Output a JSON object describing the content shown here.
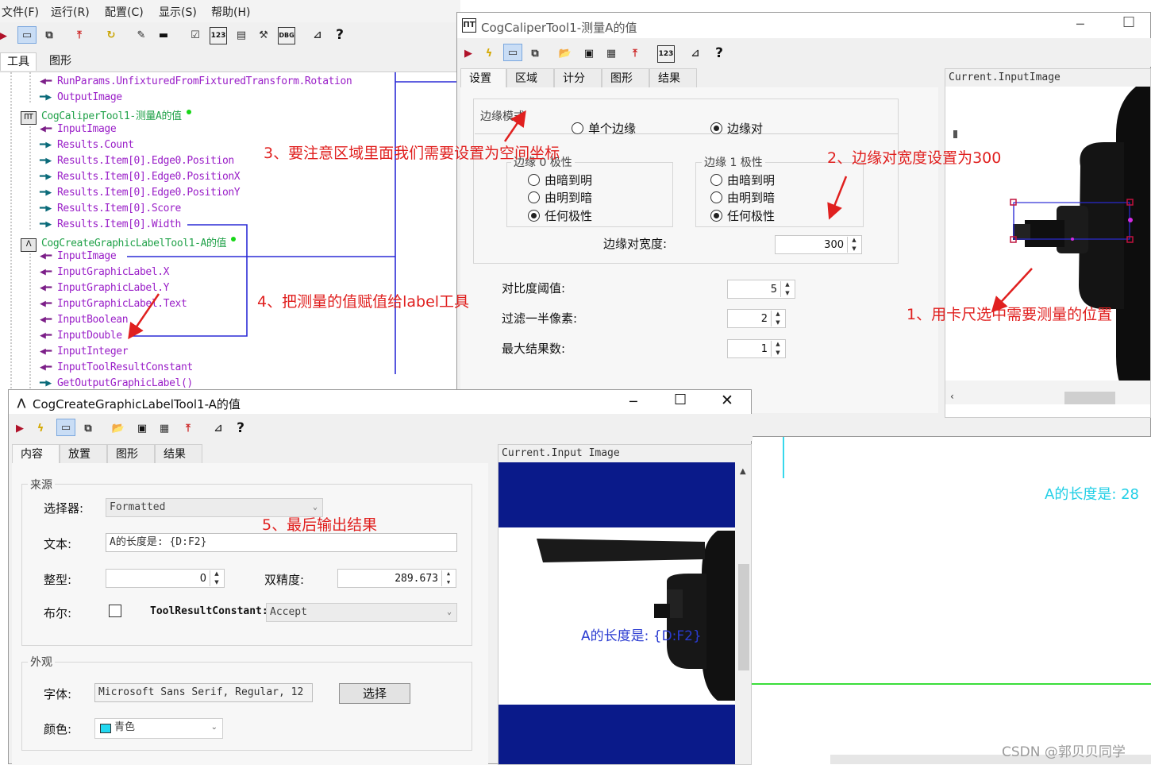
{
  "menu": [
    "文件(F)",
    "运行(R)",
    "配置(C)",
    "显示(S)",
    "帮助(H)"
  ],
  "main_tabs": [
    "工具",
    "图形"
  ],
  "tree": [
    {
      "text": "RunParams.UnfixturedFromFixturedTransform.Rotation",
      "dir": "in"
    },
    {
      "text": "OutputImage",
      "dir": "out"
    },
    {
      "text": "CogCaliperTool1-测量A的值",
      "dir": "tool"
    },
    {
      "text": "InputImage",
      "dir": "in"
    },
    {
      "text": "Results.Count",
      "dir": "out"
    },
    {
      "text": "Results.Item[0].Edge0.Position",
      "dir": "out"
    },
    {
      "text": "Results.Item[0].Edge0.PositionX",
      "dir": "out"
    },
    {
      "text": "Results.Item[0].Edge0.PositionY",
      "dir": "out"
    },
    {
      "text": "Results.Item[0].Score",
      "dir": "out"
    },
    {
      "text": "Results.Item[0].Width",
      "dir": "out"
    },
    {
      "text": "CogCreateGraphicLabelTool1-A的值",
      "dir": "tool"
    },
    {
      "text": "InputImage",
      "dir": "in"
    },
    {
      "text": "InputGraphicLabel.X",
      "dir": "in"
    },
    {
      "text": "InputGraphicLabel.Y",
      "dir": "in"
    },
    {
      "text": "InputGraphicLabel.Text",
      "dir": "in"
    },
    {
      "text": "InputBoolean",
      "dir": "in"
    },
    {
      "text": "InputDouble",
      "dir": "in"
    },
    {
      "text": "InputInteger",
      "dir": "in"
    },
    {
      "text": "InputToolResultConstant",
      "dir": "in"
    },
    {
      "text": "GetOutputGraphicLabel()",
      "dir": "out"
    }
  ],
  "caliper": {
    "title": "CogCaliperTool1-测量A的值",
    "tabs": [
      "设置",
      "区域",
      "计分",
      "图形",
      "结果"
    ],
    "edge_mode_label": "边缘模式",
    "single_edge": "单个边缘",
    "edge_pair": "边缘对",
    "edge0_polarity": "边缘 0 极性",
    "edge1_polarity": "边缘 1 极性",
    "dark_to_light": "由暗到明",
    "light_to_dark": "由明到暗",
    "any_polarity": "任何极性",
    "pair_width_label": "边缘对宽度:",
    "pair_width": "300",
    "contrast_label": "对比度阈值:",
    "contrast": "5",
    "filter_label": "过滤一半像素:",
    "filter": "2",
    "max_results_label": "最大结果数:",
    "max_results": "1",
    "image_header": "Current.InputImage",
    "scroll_left": "‹"
  },
  "label_tool": {
    "title": "CogCreateGraphicLabelTool1-A的值",
    "tabs": [
      "内容",
      "放置",
      "图形",
      "结果"
    ],
    "source_label": "来源",
    "selector_label": "选择器:",
    "selector_value": "Formatted",
    "text_label": "文本:",
    "text_value": "A的长度是: {D:F2}",
    "integer_label": "整型:",
    "integer_value": "0",
    "double_label": "双精度:",
    "double_value": "289.673",
    "bool_label": "布尔:",
    "trc_label": "ToolResultConstant:",
    "trc_value": "Accept",
    "appearance_label": "外观",
    "font_label": "字体:",
    "font_value": "Microsoft Sans Serif, Regular, 12",
    "choose_button": "选择",
    "color_label": "颜色:",
    "color_value": "青色",
    "image_header": "Current.Input Image",
    "overlay_text": "A的长度是: {D:F2}"
  },
  "background_label": "A的长度是: 28",
  "annotations": [
    "3、要注意区域里面我们需要设置为空间坐标",
    "2、边缘对宽度设置为300",
    "4、把测量的值赋值给label工具",
    "1、用卡尺选中需要测量的位置",
    "5、最后输出结果"
  ],
  "watermark": "CSDN @郭贝贝同学",
  "colors": {
    "annotation": "#e0201f",
    "cyan_label": "#22cfe6",
    "blue_label": "#2a3bd1",
    "tree_link": "#2b2bd6",
    "image_band": "#0a1a8a"
  }
}
